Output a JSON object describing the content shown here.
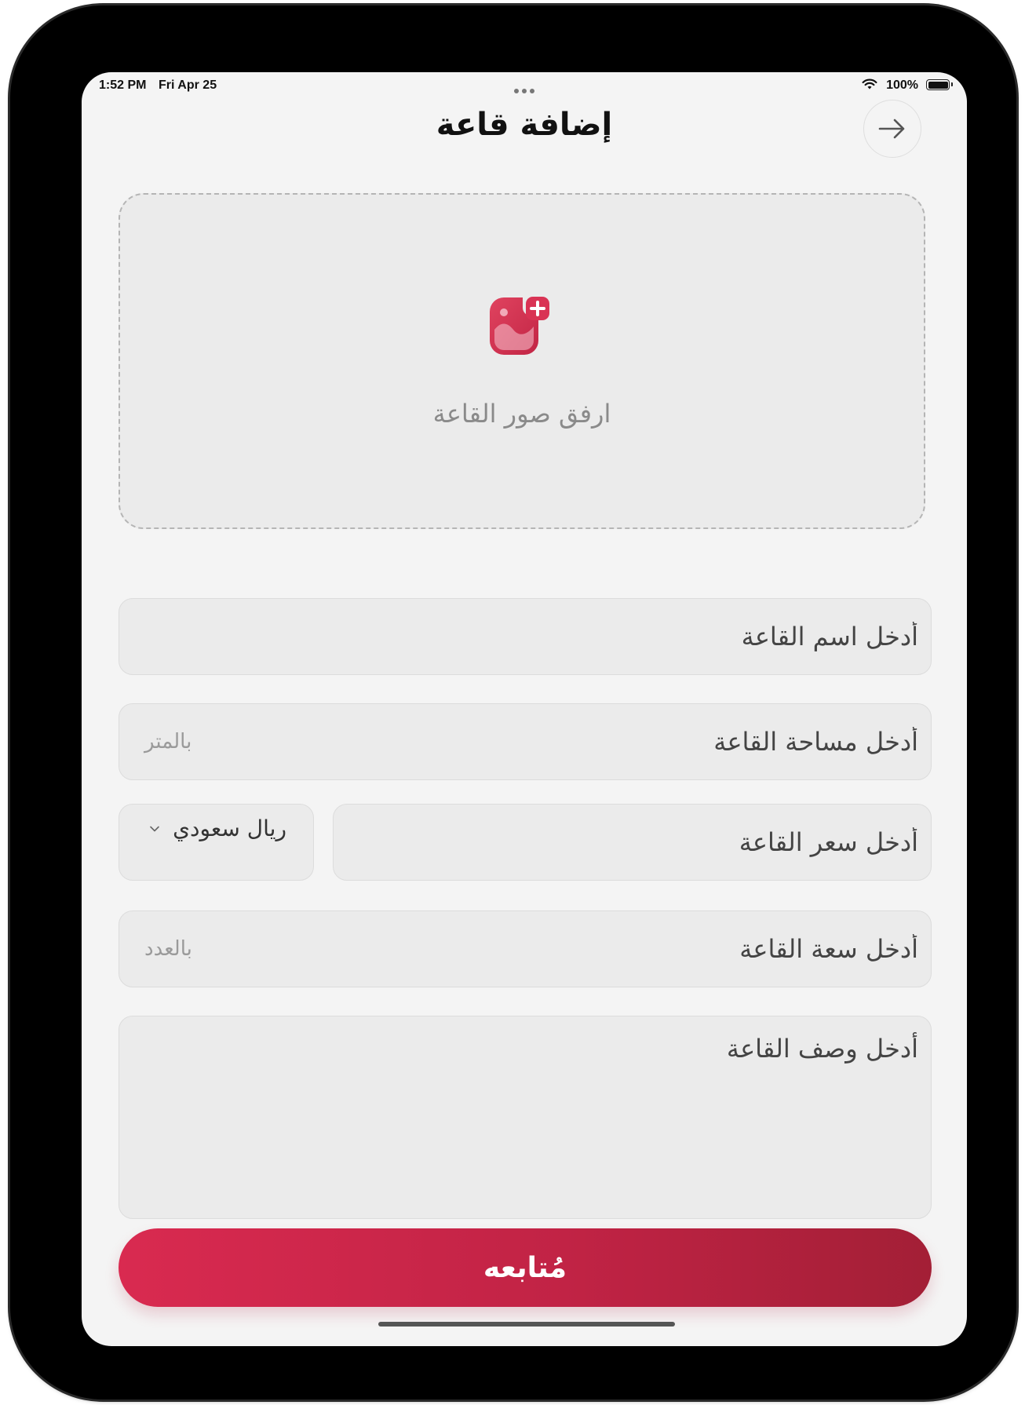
{
  "status_bar": {
    "time": "1:52 PM",
    "date": "Fri Apr 25",
    "battery": "100%"
  },
  "header": {
    "title": "إضافة قاعة",
    "back_icon": "arrow-right-icon"
  },
  "upload": {
    "label": "ارفق صور القاعة",
    "icon": "image-add-icon"
  },
  "form": {
    "name": {
      "placeholder": "أدخل اسم القاعة"
    },
    "area": {
      "placeholder": "أدخل مساحة القاعة",
      "unit": "بالمتر"
    },
    "price": {
      "placeholder": "أدخل سعر القاعة"
    },
    "currency": {
      "value": "ريال سعودي",
      "icon": "chevron-down-icon"
    },
    "capacity": {
      "placeholder": "أدخل سعة القاعة",
      "unit": "بالعدد"
    },
    "description": {
      "placeholder": "أدخل وصف القاعة"
    }
  },
  "actions": {
    "continue_label": "مُتابعه"
  },
  "colors": {
    "accent": "#c72447",
    "accent_dark": "#a31f36",
    "background": "#f4f4f4",
    "field_background": "#ebebeb"
  }
}
